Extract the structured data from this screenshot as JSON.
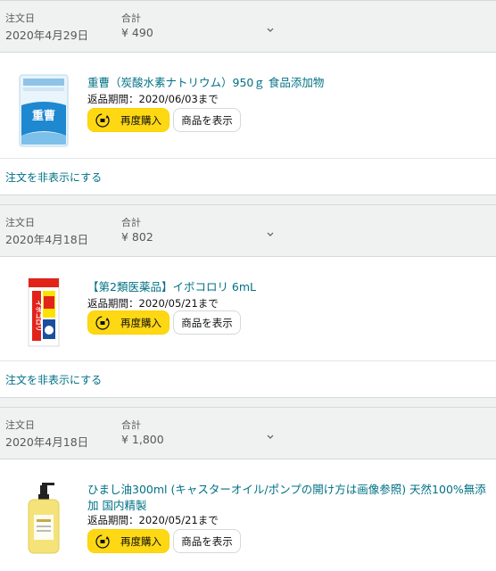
{
  "labels": {
    "order_date": "注文日",
    "total": "合計",
    "rebuy": "再度購入",
    "view_item": "商品を表示",
    "hide_order": "注文を非表示にする"
  },
  "orders": [
    {
      "date": "2020年4月29日",
      "total": "¥ 490",
      "item_title": "重曹（炭酸水素ナトリウム）950ｇ 食品添加物",
      "return_period": "返品期間：2020/06/03まで",
      "thumb_icon": "baking-soda-package-icon",
      "thumb_text": "重曹"
    },
    {
      "date": "2020年4月18日",
      "total": "¥ 802",
      "item_title": "【第2類医薬品】イボコロリ 6mL",
      "return_period": "返品期間：2020/05/21まで",
      "thumb_icon": "ibokorori-medicine-box-icon",
      "thumb_text": "イボコロリ"
    },
    {
      "date": "2020年4月18日",
      "total": "¥ 1,800",
      "item_title": "ひまし油300ml (キャスターオイル/ポンプの開け方は画像参照) 天然100%無添加 国内精製",
      "return_period": "返品期間：2020/05/21まで",
      "thumb_icon": "castor-oil-pump-bottle-icon"
    }
  ],
  "colors": {
    "link": "#007185",
    "buy_button": "#FFD814",
    "header_bg": "#F0F2F2"
  }
}
